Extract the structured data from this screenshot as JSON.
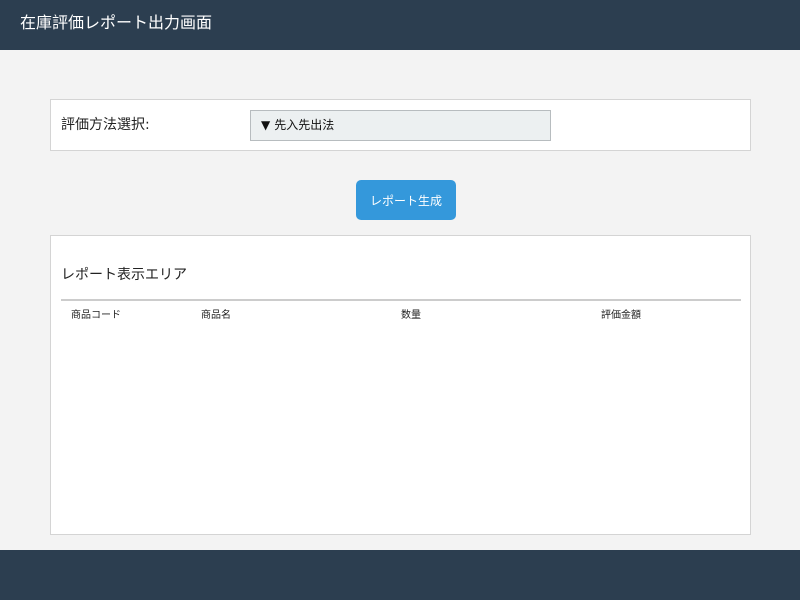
{
  "header": {
    "title": "在庫評価レポート出力画面"
  },
  "method": {
    "label": "評価方法選択:",
    "selected": "先入先出法",
    "arrow_icon": "▼"
  },
  "actions": {
    "generate_label": "レポート生成"
  },
  "report": {
    "title": "レポート表示エリア",
    "columns": [
      "商品コード",
      "商品名",
      "数量",
      "評価金額"
    ],
    "rows": []
  },
  "colors": {
    "header_bg": "#2c3e50",
    "button_bg": "#3498db",
    "select_bg": "#ecf0f1",
    "page_bg": "#f3f3f3"
  }
}
